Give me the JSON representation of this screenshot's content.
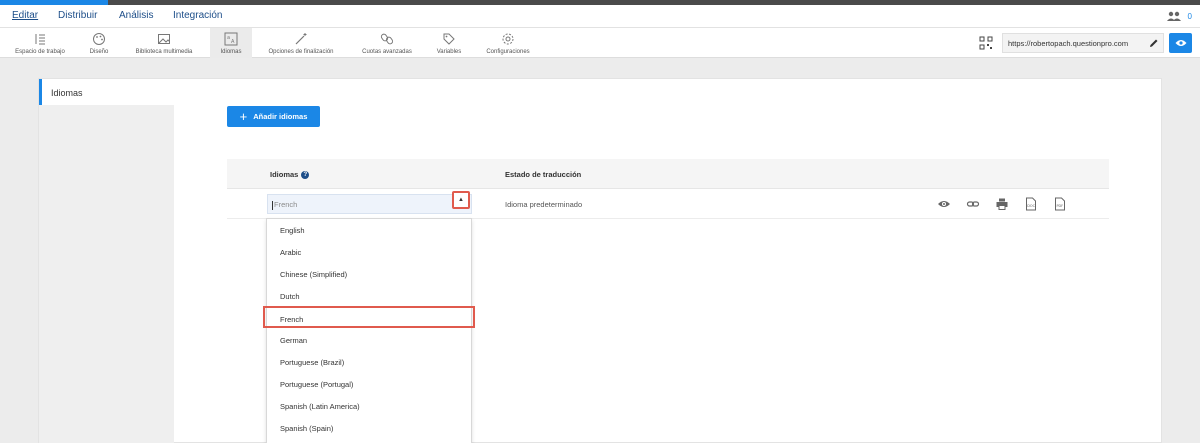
{
  "nav": {
    "items": [
      "Editar",
      "Distribuir",
      "Análisis",
      "Integración"
    ],
    "users_count": "0"
  },
  "toolbar": {
    "tools": [
      {
        "label": "Espacio de trabajo",
        "icon": "workspace-icon"
      },
      {
        "label": "Diseño",
        "icon": "palette-icon"
      },
      {
        "label": "Biblioteca multimedia",
        "icon": "image-icon"
      },
      {
        "label": "Idiomas",
        "icon": "translate-icon"
      },
      {
        "label": "Opciones de finalización",
        "icon": "magic-wand-icon"
      },
      {
        "label": "Cuotas avanzadas",
        "icon": "chain-icon"
      },
      {
        "label": "Variables",
        "icon": "tag-icon"
      },
      {
        "label": "Configuraciones",
        "icon": "gear-icon"
      }
    ],
    "survey_url": "https://robertopach.questionpro.com"
  },
  "card": {
    "title": "Idiomas",
    "add_button": "Añadir idiomas",
    "table": {
      "col_languages": "Idiomas",
      "col_status": "Estado de traducción",
      "row": {
        "language": "French",
        "status": "Idioma predeterminado"
      }
    }
  },
  "dropdown": {
    "options": [
      "English",
      "Arabic",
      "Chinese (Simplified)",
      "Dutch",
      "French",
      "German",
      "Portuguese (Brazil)",
      "Portuguese (Portugal)",
      "Spanish (Latin America)",
      "Spanish (Spain)"
    ],
    "highlighted": "French"
  },
  "colors": {
    "accent": "#1b87e6",
    "highlight_border": "#e05a4d",
    "nav_text": "#1d4e89"
  }
}
